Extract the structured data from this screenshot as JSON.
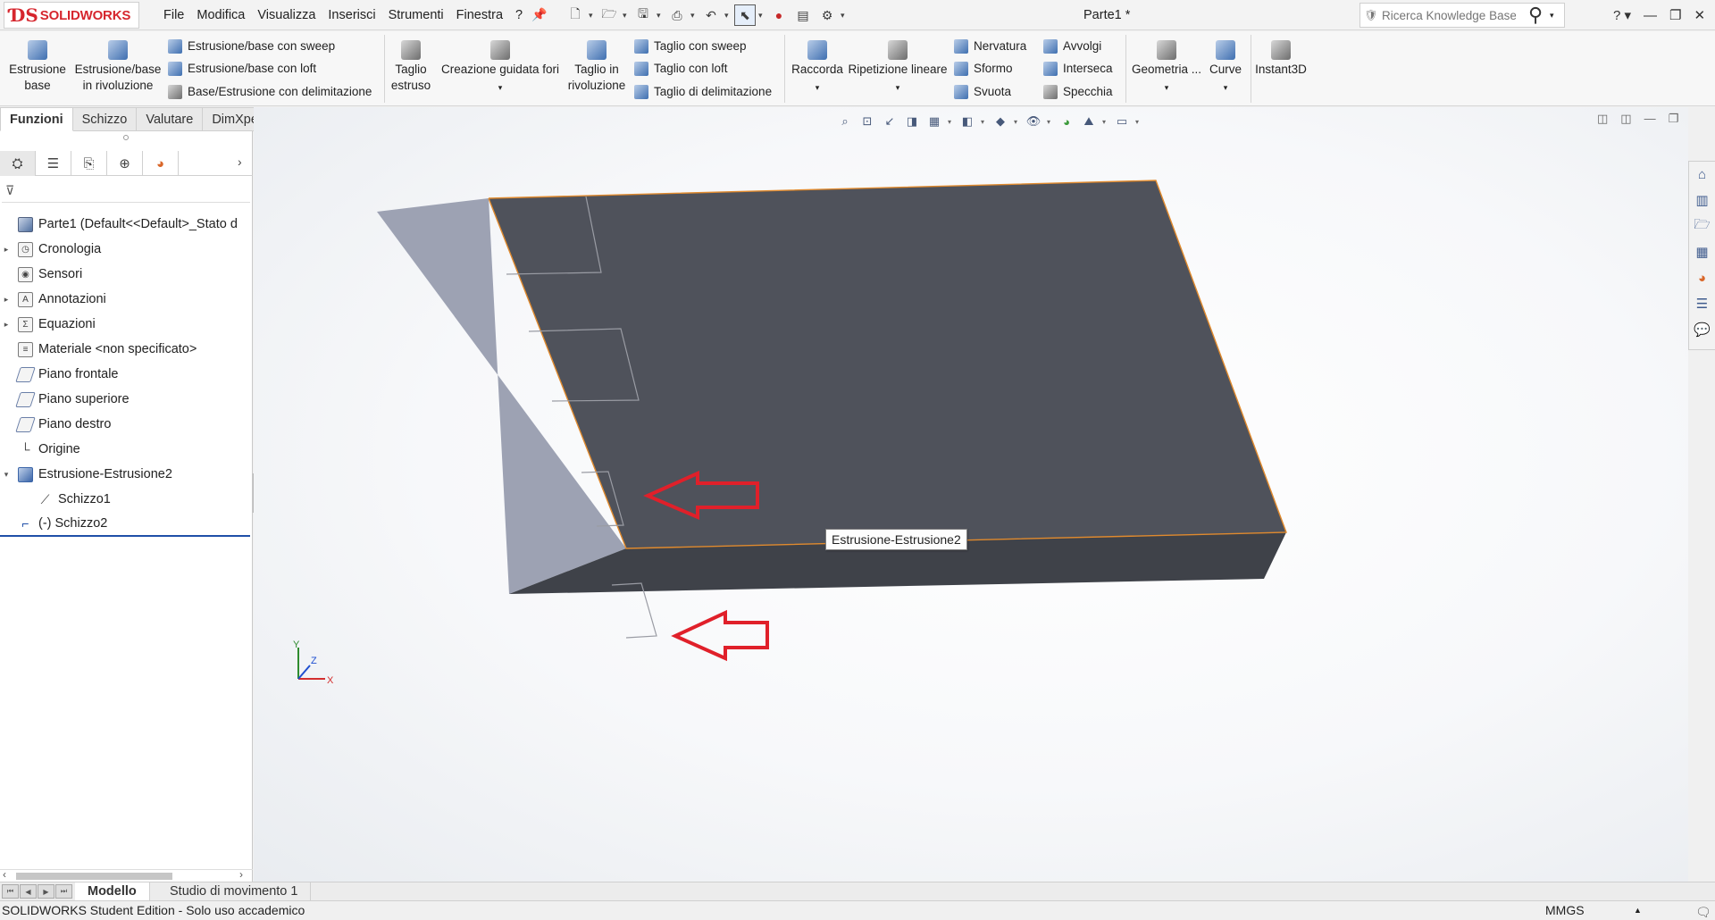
{
  "app": {
    "logo_text": "SOLIDWORKS",
    "doc_title": "Parte1 *"
  },
  "menu": [
    "File",
    "Modifica",
    "Visualizza",
    "Inserisci",
    "Strumenti",
    "Finestra",
    "?"
  ],
  "search": {
    "placeholder": "Ricerca Knowledge Base"
  },
  "ribbon": {
    "estrusione_base": [
      "Estrusione",
      "base"
    ],
    "estrusione_rivoluzione": [
      "Estrusione/base",
      "in rivoluzione"
    ],
    "sweep": "Estrusione/base con sweep",
    "loft": "Estrusione/base con loft",
    "delimitazione": "Base/Estrusione con delimitazione",
    "taglio_estruso": [
      "Taglio",
      "estruso"
    ],
    "creazione_fori": "Creazione guidata fori",
    "taglio_rivoluzione": [
      "Taglio in",
      "rivoluzione"
    ],
    "taglio_sweep": "Taglio con sweep",
    "taglio_loft": "Taglio con loft",
    "taglio_delimitazione": "Taglio di delimitazione",
    "raccorda": "Raccorda",
    "ripetizione_lineare": "Ripetizione lineare",
    "nervatura": "Nervatura",
    "sformo": "Sformo",
    "svuota": "Svuota",
    "avvolgi": "Avvolgi",
    "interseca": "Interseca",
    "specchia": "Specchia",
    "geometria": "Geometria ...",
    "curve": "Curve",
    "instant3d": "Instant3D"
  },
  "command_tabs": [
    "Funzioni",
    "Schizzo",
    "Valutare",
    "DimXpert"
  ],
  "tree": [
    {
      "label": "Parte1  (Default<<Default>_Stato d",
      "icon": "part-icon",
      "indent": 0,
      "expander": ""
    },
    {
      "label": "Cronologia",
      "icon": "history-icon",
      "indent": 0,
      "expander": "▸"
    },
    {
      "label": "Sensori",
      "icon": "sensor-icon",
      "indent": 0,
      "expander": ""
    },
    {
      "label": "Annotazioni",
      "icon": "annotation-icon",
      "indent": 0,
      "expander": "▸"
    },
    {
      "label": "Equazioni",
      "icon": "equation-icon",
      "indent": 0,
      "expander": "▸"
    },
    {
      "label": "Materiale <non specificato>",
      "icon": "material-icon",
      "indent": 0,
      "expander": ""
    },
    {
      "label": "Piano frontale",
      "icon": "plane-icon",
      "indent": 0,
      "expander": ""
    },
    {
      "label": "Piano superiore",
      "icon": "plane-icon",
      "indent": 0,
      "expander": ""
    },
    {
      "label": "Piano destro",
      "icon": "plane-icon",
      "indent": 0,
      "expander": ""
    },
    {
      "label": "Origine",
      "icon": "origin-icon",
      "indent": 0,
      "expander": ""
    },
    {
      "label": "Estrusione-Estrusione2",
      "icon": "extrude-feature-icon",
      "indent": 0,
      "expander": "▾"
    },
    {
      "label": "Schizzo1",
      "icon": "sketch-icon",
      "indent": 1,
      "expander": ""
    },
    {
      "label": "(-) Schizzo2",
      "icon": "sketch-icon",
      "indent": 0,
      "expander": ""
    }
  ],
  "viewport": {
    "tooltip": "Estrusione-Estrusione2",
    "triad": {
      "y": "Y",
      "z": "Z",
      "x": "X"
    },
    "colors": {
      "top_face": "#4f525b",
      "side_face": "#9da2b3",
      "front_face": "#3f4249",
      "edge": "#e08a2e",
      "arrow": "#e0202a"
    }
  },
  "bottom_tabs": [
    "Modello",
    "Studio di movimento 1"
  ],
  "status": {
    "text": "SOLIDWORKS Student Edition - Solo uso accademico",
    "units": "MMGS"
  }
}
